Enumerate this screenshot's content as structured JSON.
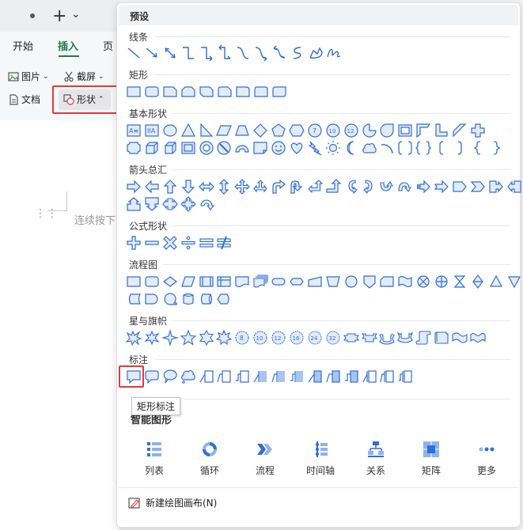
{
  "titlebar": {
    "new_tab_symbol": "+",
    "dropdown_symbol": "⌄"
  },
  "ribbon": {
    "tabs": [
      {
        "label": "开始"
      },
      {
        "label": "插入",
        "active": true
      },
      {
        "label": "页"
      }
    ],
    "picture_label": "图片",
    "screenshot_label": "截屏",
    "doc_label": "文档",
    "shapes_label": "形状"
  },
  "document": {
    "body_text": "连续按下"
  },
  "panel": {
    "header": "预设",
    "sections": [
      {
        "title": "线条"
      },
      {
        "title": "矩形"
      },
      {
        "title": "基本形状"
      },
      {
        "title": "箭头总汇"
      },
      {
        "title": "公式形状"
      },
      {
        "title": "流程图"
      },
      {
        "title": "星与旗帜"
      },
      {
        "title": "标注"
      }
    ],
    "smart_title": "智能图形",
    "smart_items": [
      {
        "label": "列表",
        "icon": "list-icon"
      },
      {
        "label": "循环",
        "icon": "cycle-icon"
      },
      {
        "label": "流程",
        "icon": "process-icon"
      },
      {
        "label": "时间轴",
        "icon": "timeline-icon"
      },
      {
        "label": "关系",
        "icon": "hierarchy-icon"
      },
      {
        "label": "矩阵",
        "icon": "matrix-icon"
      },
      {
        "label": "更多",
        "icon": "more-icon"
      }
    ],
    "new_canvas_label": "新建绘图画布(N)",
    "tooltip": "矩形标注"
  },
  "colors": {
    "accent_green": "#1f7a4d",
    "shape_blue": "#2f6fd6",
    "shape_fill": "#e3ebfb",
    "highlight_red": "#e5393a"
  }
}
